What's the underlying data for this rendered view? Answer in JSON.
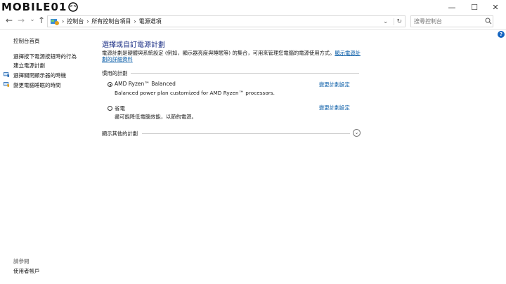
{
  "window": {
    "logo_text": "MOBILE01",
    "minimize_glyph": "—",
    "maximize_glyph": "☐",
    "close_glyph": "✕"
  },
  "nav": {
    "back_glyph": "←",
    "forward_glyph": "→",
    "down_glyph": "⌄",
    "up_glyph": "↑",
    "breadcrumb": [
      "控制台",
      "所有控制台項目",
      "電源選項"
    ],
    "separator": "›",
    "dropdown_glyph": "⌄",
    "refresh_glyph": "↻",
    "search_placeholder": "搜尋控制台"
  },
  "help_glyph": "?",
  "sidebar": {
    "home": "控制台首頁",
    "items": [
      "選擇按下電源按鈕時的行為",
      "建立電源計劃",
      "選擇關閉顯示器的時機",
      "變更電腦睡眠的時間"
    ],
    "see_also_label": "請參閱",
    "see_also_items": [
      "使用者帳戶"
    ]
  },
  "main": {
    "title": "選擇或自訂電源計劃",
    "description": "電源計劃是硬體與系統設定 (例如，顯示器亮度與睡眠等) 的集合，可用來管理您電腦的電源使用方式。",
    "description_link": "顯示電源計劃的詳細資料",
    "preferred_group": "慣用的計劃",
    "plans": [
      {
        "name": "AMD Ryzen™ Balanced",
        "description": "Balanced power plan customized for AMD Ryzen™ processors.",
        "link": "變更計劃設定",
        "selected": true
      },
      {
        "name": "省電",
        "description": "盡可能降低電腦效能，以節約電源。",
        "link": "變更計劃設定",
        "selected": false
      }
    ],
    "more_plans": "顯示其他的計劃",
    "expand_glyph": "⌄"
  }
}
